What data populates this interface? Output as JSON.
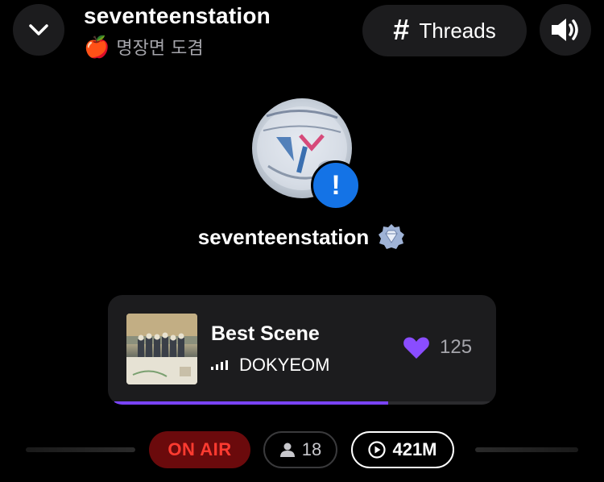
{
  "header": {
    "station_name": "seventeenstation",
    "subtitle_emoji": "🍎",
    "subtitle": "명장면 도겸",
    "threads_label": "Threads",
    "back_icon": "chevron-down-icon",
    "sound_icon": "speaker-icon"
  },
  "profile": {
    "name": "seventeenstation",
    "badge_icon": "verified-diamond-icon",
    "alert_symbol": "!"
  },
  "now_playing": {
    "title": "Best Scene",
    "artist": "DOKYEOM",
    "likes": "125",
    "progress": 0.73,
    "accent_color": "#7a44ff"
  },
  "status": {
    "on_air": "ON AIR",
    "listeners": "18",
    "plays": "421M"
  }
}
